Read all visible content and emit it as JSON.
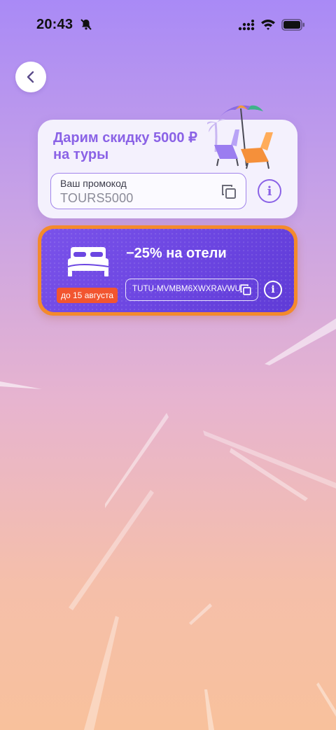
{
  "status_bar": {
    "time": "20:43"
  },
  "back": {
    "icon": "chevron-left-icon"
  },
  "tours_offer": {
    "title": "Дарим скидку 5000 ₽ на туры",
    "promo_label": "Ваш промокод",
    "promo_code": "TOURS5000",
    "info_glyph": "i",
    "accent_color": "#8a62e6"
  },
  "hotel_offer": {
    "title": "−25% на отели",
    "deadline_badge": "до 15 августа",
    "promo_code": "TUTU-MVMBM6XWXRAVWU",
    "info_glyph": "i",
    "border_color": "#f48a2c",
    "badge_color": "#f2552f"
  }
}
